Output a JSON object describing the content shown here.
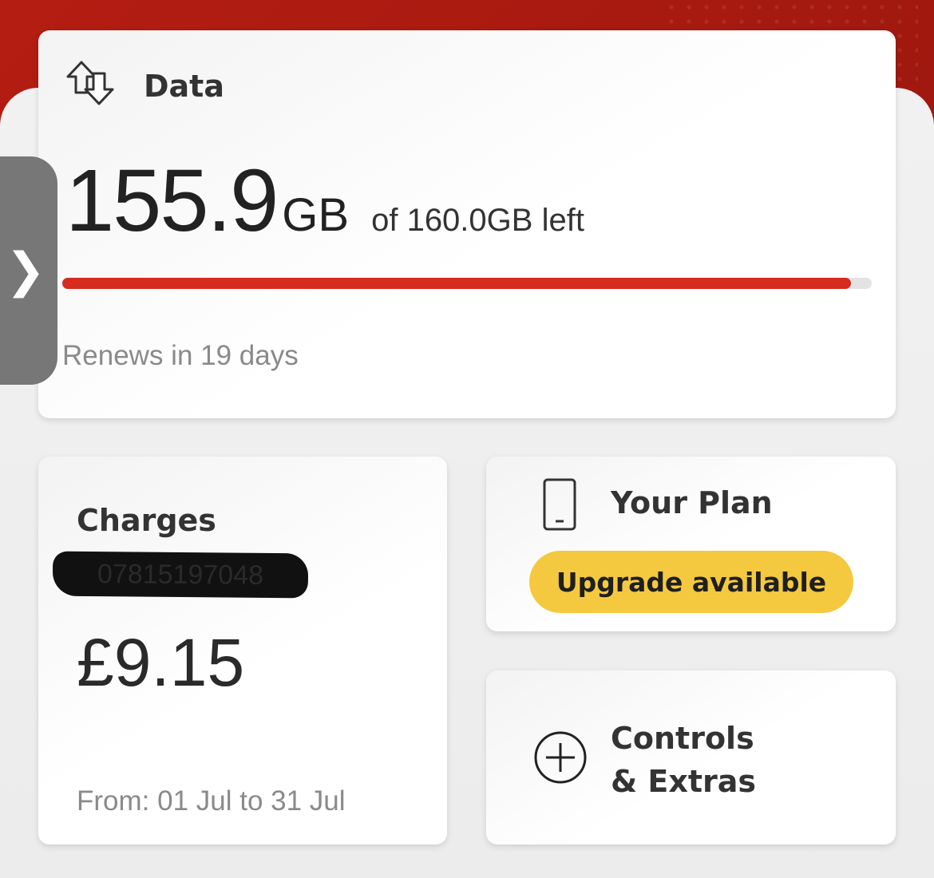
{
  "data_card": {
    "title": "Data",
    "icon": "data-transfer-icon",
    "amount": "155.9",
    "unit": "GB",
    "allowance_text": "of 160.0GB left",
    "remaining_fraction": 0.974,
    "renews_text": "Renews in 19 days"
  },
  "side_tab": {
    "icon": "chevron-right-icon",
    "glyph": "❯"
  },
  "charges_card": {
    "title": "Charges",
    "redacted_number": "07815197048",
    "amount": "£9.15",
    "period": "From: 01 Jul to 31 Jul"
  },
  "plan_card": {
    "title": "Your Plan",
    "icon": "phone-icon",
    "upgrade_label": "Upgrade available"
  },
  "extras_card": {
    "icon": "plus-circle-icon",
    "title_line1": "Controls",
    "title_line2": "& Extras"
  },
  "colors": {
    "brand_red": "#d62b1f",
    "header_red": "#b41d12",
    "upgrade_yellow": "#f4c940"
  }
}
